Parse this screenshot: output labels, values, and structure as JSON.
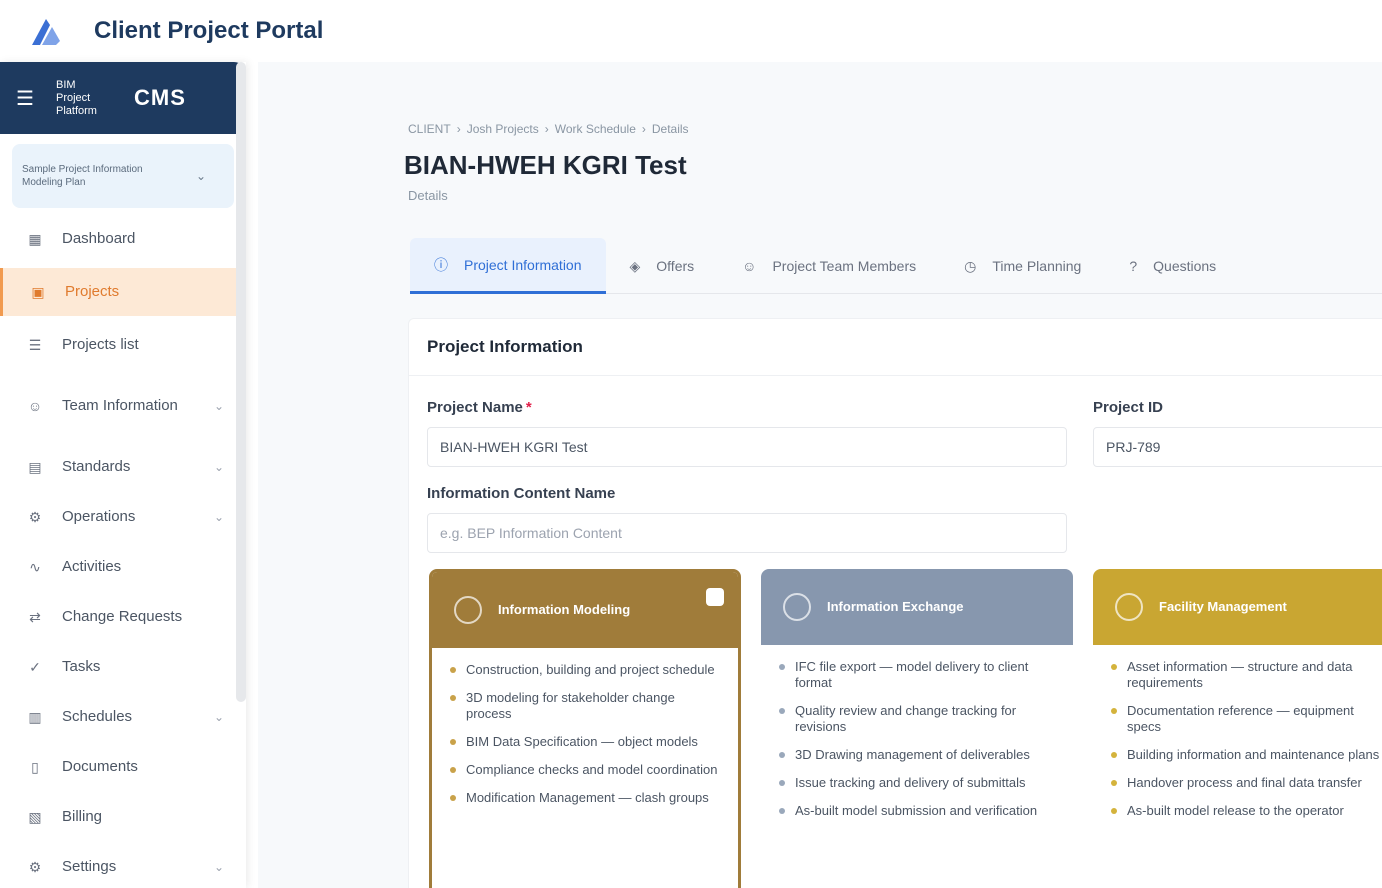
{
  "app": {
    "title": "Client Project Portal"
  },
  "sidebar": {
    "header": {
      "platform": "BIM Project Platform",
      "abbr": "CMS"
    },
    "project": {
      "name": "Sample Project Information Modeling Plan"
    },
    "items": [
      {
        "label": "Dashboard",
        "icon": "grid-icon",
        "expandable": false
      },
      {
        "label": "Projects",
        "icon": "folder-icon",
        "expandable": false,
        "active": true
      },
      {
        "label": "Projects list",
        "icon": "list-icon",
        "expandable": false
      },
      {
        "label": "Team Information",
        "icon": "users-icon",
        "expandable": true
      },
      {
        "label": "Standards",
        "icon": "book-icon",
        "expandable": true
      },
      {
        "label": "Operations",
        "icon": "gear-icon",
        "expandable": true
      },
      {
        "label": "Activities",
        "icon": "activity-icon",
        "expandable": false
      },
      {
        "label": "Change Requests",
        "icon": "swap-icon",
        "expandable": false
      },
      {
        "label": "Tasks",
        "icon": "check-icon",
        "expandable": false
      },
      {
        "label": "Schedules",
        "icon": "calendar-icon",
        "expandable": true
      },
      {
        "label": "Documents",
        "icon": "document-icon",
        "expandable": false
      },
      {
        "label": "Billing",
        "icon": "receipt-icon",
        "expandable": false
      },
      {
        "label": "Settings",
        "icon": "settings-icon",
        "expandable": true
      }
    ]
  },
  "breadcrumb": [
    "CLIENT",
    "Josh Projects",
    "Work Schedule",
    "Details"
  ],
  "page": {
    "title": "BIAN-HWEH KGRI Test",
    "subtitle": "Details"
  },
  "tabs": [
    {
      "label": "Project Information",
      "icon": "info-icon",
      "active": true
    },
    {
      "label": "Offers",
      "icon": "tag-icon"
    },
    {
      "label": "Project Team Members",
      "icon": "users-icon"
    },
    {
      "label": "Time Planning",
      "icon": "clock-icon"
    },
    {
      "label": "Questions",
      "icon": "help-icon"
    }
  ],
  "card": {
    "title": "Project Information",
    "project_name": {
      "label": "Project Name",
      "value": "BIAN-HWEH KGRI Test"
    },
    "project_id": {
      "label": "Project ID",
      "value": "PRJ-789"
    },
    "info_container": {
      "label": "Information Content Name",
      "placeholder": "e.g. BEP Information Content"
    },
    "columns": [
      {
        "title": "Information Modeling",
        "items": [
          "Construction, building and project schedule",
          "3D modeling for stakeholder change process",
          "BIM Data Specification — object models",
          "Compliance checks and model coordination",
          "Modification Management — clash groups"
        ]
      },
      {
        "title": "Information Exchange",
        "items": [
          "IFC file export — model delivery to client format",
          "Quality review and change tracking for revisions",
          "3D Drawing management of deliverables",
          "Issue tracking and delivery of submittals",
          "As-built model submission and verification"
        ]
      },
      {
        "title": "Facility Management",
        "items": [
          "Asset information — structure and data requirements",
          "Documentation reference — equipment specs",
          "Building information and maintenance plans",
          "Handover process and final data transfer",
          "As-built model release to the operator"
        ]
      }
    ]
  }
}
